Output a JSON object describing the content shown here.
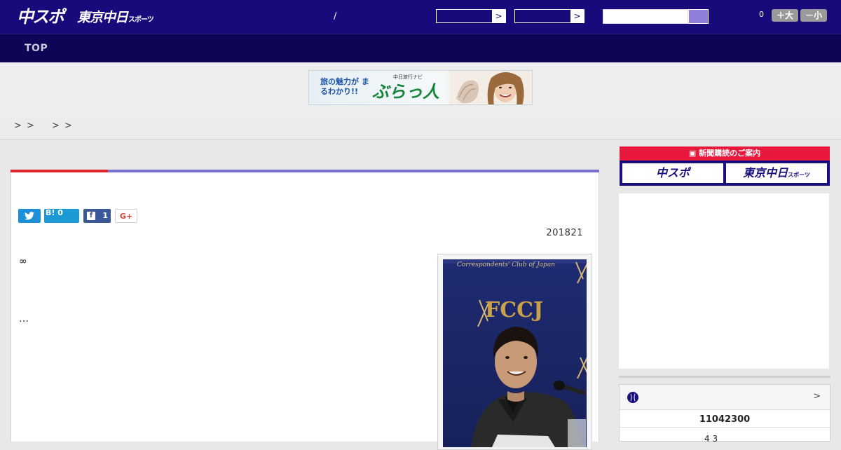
{
  "header": {
    "logo_chuspo": "中スポ",
    "logo_tokyo": "東京中日",
    "logo_tokyo_sub": "スポーツ",
    "separator": "/",
    "select_arrow": ">",
    "font_size_value": "0",
    "font_plus_label": "＋大",
    "font_minus_label": "－小",
    "colors": {
      "header_bg": "#180a7a",
      "nav_bg": "#0e0557",
      "accent": "#8f7fdb"
    }
  },
  "nav": {
    "top_label": "TOP"
  },
  "banner": {
    "tagline": "旅の魅力が まるわかり!!",
    "sub": "中日旅行ナビ",
    "brand": "ぶらっ人"
  },
  "breadcrumb": {
    "separators": [
      ">",
      ">",
      ">",
      ">"
    ]
  },
  "article": {
    "share": {
      "twitter_icon": "twitter-bird-icon",
      "hatena_label": "B!",
      "hatena_count": "0",
      "facebook_label": "f",
      "facebook_count": "1",
      "gplus_label": "G+"
    },
    "date": "201821",
    "paragraphs": [
      "∞",
      "…"
    ],
    "photo_caption_visible": "Correspondents' Club of Japan"
  },
  "sidebar": {
    "subscribe_title": "新聞購読のご案内",
    "subscribe_chuspo": "中スポ",
    "subscribe_tokyo": "東京中日",
    "subscribe_tokyo_sub": "スポーツ",
    "score": {
      "more": ">",
      "game_id": "11042300",
      "line": "4  3"
    }
  }
}
